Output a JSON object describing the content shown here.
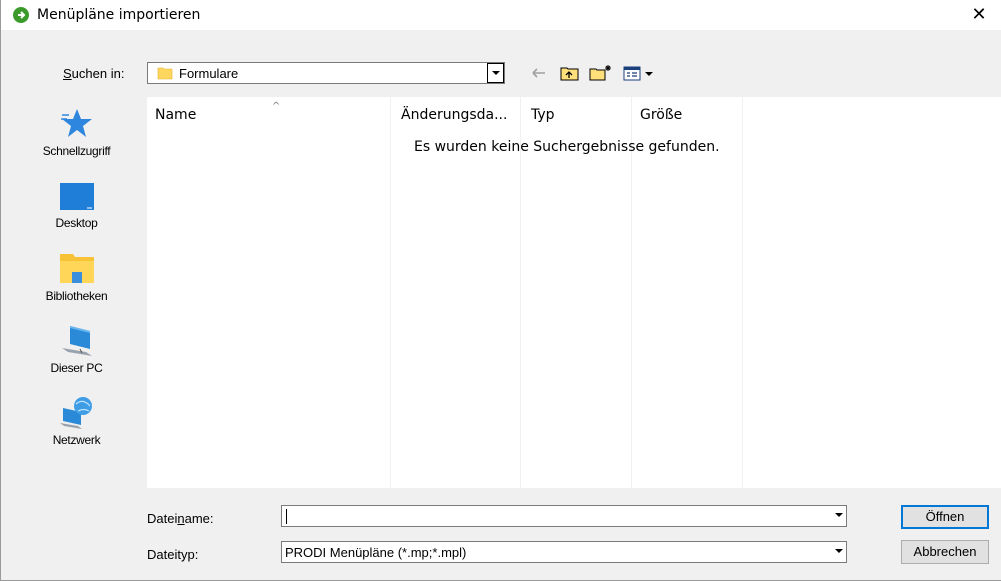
{
  "window": {
    "title": "Menüpläne importieren",
    "close_glyph": "✕"
  },
  "lookin": {
    "label": "Suchen in:",
    "value": "Formulare"
  },
  "toolbar": {
    "back_icon": "back-arrow-icon",
    "up_icon": "folder-up-icon",
    "newfolder_icon": "new-folder-icon",
    "view_icon": "view-menu-icon"
  },
  "places": [
    {
      "label": "Schnellzugriff",
      "icon": "star-icon"
    },
    {
      "label": "Desktop",
      "icon": "desktop-icon"
    },
    {
      "label": "Bibliotheken",
      "icon": "libraries-icon"
    },
    {
      "label": "Dieser PC",
      "icon": "computer-icon"
    },
    {
      "label": "Netzwerk",
      "icon": "network-icon"
    }
  ],
  "columns": [
    "Name",
    "Änderungsda...",
    "Typ",
    "Größe"
  ],
  "empty_message": "Es wurden keine Suchergebnisse gefunden.",
  "filename": {
    "label": "Dateiname:",
    "value": ""
  },
  "filetype": {
    "label": "Dateityp:",
    "value": "PRODI Menüpläne (*.mp;*.mpl)"
  },
  "buttons": {
    "open": "Öffnen",
    "cancel": "Abbrechen"
  },
  "colors": {
    "accent": "#0078d7",
    "title_icon": "#3c9a2d"
  }
}
